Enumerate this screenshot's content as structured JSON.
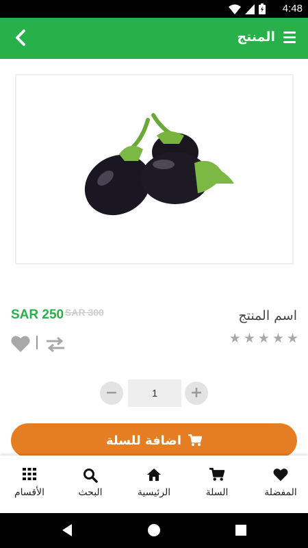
{
  "status": {
    "time": "4:48"
  },
  "header": {
    "title": "المنتج"
  },
  "product": {
    "name": "اسم المنتج",
    "price": "SAR 250",
    "old_price": "SAR 300",
    "rating": 0,
    "max_rating": 5
  },
  "quantity": {
    "value": "1"
  },
  "actions": {
    "add_to_cart": "اضافة للسلة"
  },
  "bottom_nav": {
    "items": [
      {
        "label": "المفضلة",
        "icon": "heart-icon"
      },
      {
        "label": "السلة",
        "icon": "cart-icon"
      },
      {
        "label": "الرئيسية",
        "icon": "home-icon"
      },
      {
        "label": "البحث",
        "icon": "search-icon"
      },
      {
        "label": "الأقسام",
        "icon": "grid-icon"
      }
    ]
  },
  "colors": {
    "primary": "#28b04a",
    "accent": "#e57d23",
    "star": "#a8a8a8"
  }
}
